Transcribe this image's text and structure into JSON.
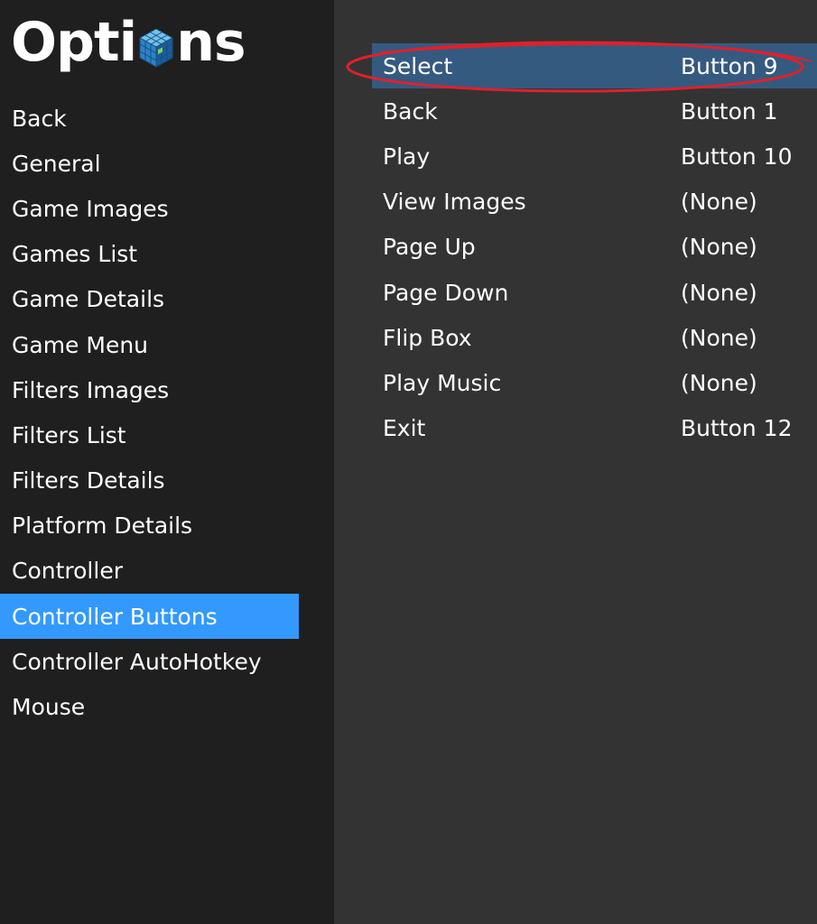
{
  "header": {
    "title_before": "Opti",
    "title_after": "ns",
    "logo_icon": "cube-icon"
  },
  "sidebar": {
    "items": [
      {
        "label": "Back"
      },
      {
        "label": "General"
      },
      {
        "label": "Game Images"
      },
      {
        "label": "Games List"
      },
      {
        "label": "Game Details"
      },
      {
        "label": "Game Menu"
      },
      {
        "label": "Filters Images"
      },
      {
        "label": "Filters List"
      },
      {
        "label": "Filters Details"
      },
      {
        "label": "Platform Details"
      },
      {
        "label": "Controller"
      },
      {
        "label": "Controller Buttons",
        "selected": true
      },
      {
        "label": "Controller AutoHotkey"
      },
      {
        "label": "Mouse"
      }
    ]
  },
  "bindings": {
    "rows": [
      {
        "action": "Select",
        "button": "Button 9",
        "highlighted": true
      },
      {
        "action": "Back",
        "button": "Button 1"
      },
      {
        "action": "Play",
        "button": "Button 10"
      },
      {
        "action": "View Images",
        "button": "(None)"
      },
      {
        "action": "Page Up",
        "button": "(None)"
      },
      {
        "action": "Page Down",
        "button": "(None)"
      },
      {
        "action": "Flip Box",
        "button": "(None)"
      },
      {
        "action": "Play Music",
        "button": "(None)"
      },
      {
        "action": "Exit",
        "button": "Button 12"
      }
    ]
  },
  "colors": {
    "sidebar_bg": "#1f1f1f",
    "content_bg": "#333333",
    "sidebar_selected": "#3399ff",
    "row_highlight": "#355a80",
    "annotation_ellipse": "#e0202a"
  }
}
